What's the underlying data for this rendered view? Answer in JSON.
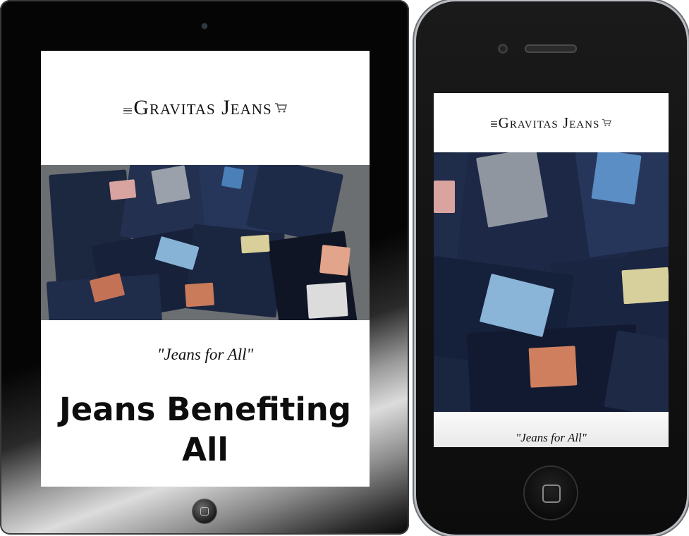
{
  "site": {
    "brand": "Gravitas Jeans",
    "tagline": "\"Jeans for All\"",
    "headline_line1": "Jeans Benefiting",
    "headline_line2": "All"
  },
  "icons": {
    "menu": "hamburger-menu-icon",
    "cart": "shopping-cart-icon"
  },
  "colors": {
    "text": "#111111",
    "denim": "#1d2a44",
    "background": "#ffffff"
  }
}
